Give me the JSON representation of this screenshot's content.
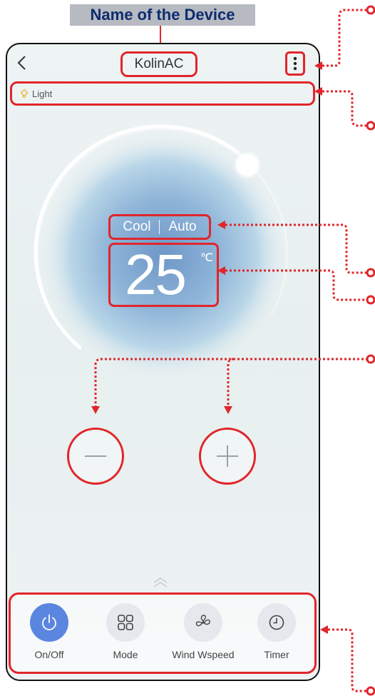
{
  "annotation": {
    "device_name_caption": "Name of the Device"
  },
  "header": {
    "title": "KolinAC",
    "back_icon": "chevron-left-icon",
    "more_icon": "vertical-dots-icon"
  },
  "light": {
    "icon": "bulb-icon",
    "label": "Light"
  },
  "climate": {
    "mode": "Cool",
    "fan": "Auto",
    "temperature": "25",
    "unit": "℃"
  },
  "controls": {
    "minus_icon": "minus-icon",
    "plus_icon": "plus-icon"
  },
  "bottom_bar": {
    "items": [
      {
        "label": "On/Off",
        "icon": "power-icon",
        "active": true
      },
      {
        "label": "Mode",
        "icon": "grid-icon",
        "active": false
      },
      {
        "label": "Wind Wspeed",
        "icon": "fan-icon",
        "active": false
      },
      {
        "label": "Timer",
        "icon": "clock-icon",
        "active": false
      }
    ]
  },
  "colors": {
    "highlight": "#e0262b",
    "accent": "#5b86e0",
    "caption_text": "#0d2c6f"
  }
}
